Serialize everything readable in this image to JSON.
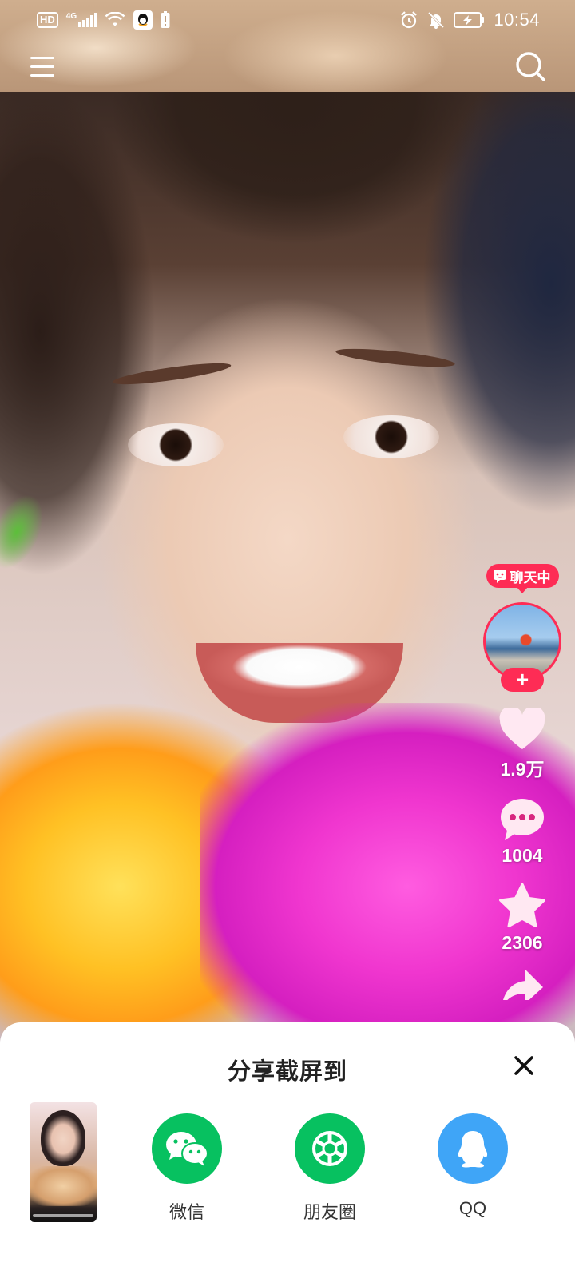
{
  "status_bar": {
    "hd_badge": "HD",
    "network": "4G",
    "time": "10:54"
  },
  "right_rail": {
    "chat_status": "聊天中",
    "follow_plus": "+",
    "likes": "1.9万",
    "comments": "1004",
    "favorites": "2306"
  },
  "share_sheet": {
    "title": "分享截屏到",
    "targets": [
      {
        "label": "微信",
        "icon": "wechat-icon",
        "color": "#07c160"
      },
      {
        "label": "朋友圈",
        "icon": "moments-icon",
        "color": "#07c160"
      },
      {
        "label": "QQ",
        "icon": "qq-icon",
        "color": "#3fa5f7"
      }
    ]
  },
  "colors": {
    "accent": "#fe2c55",
    "like_icon": "#ffe8f2",
    "sheet_bg": "#ffffff"
  }
}
